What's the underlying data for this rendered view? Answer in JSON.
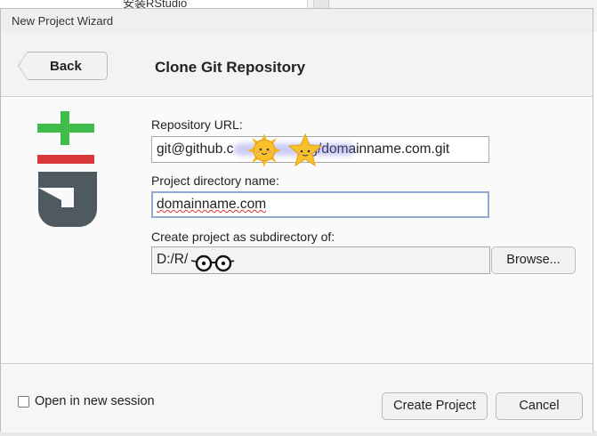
{
  "background": {
    "partial_text": "安装RStudio"
  },
  "dialog": {
    "title": "New Project Wizard",
    "back_label": "Back",
    "page_title": "Clone Git Repository"
  },
  "form": {
    "repo_url_label": "Repository URL:",
    "repo_url_prefix": "git@github.c",
    "repo_url_suffix": "g/domainname.com.git",
    "project_dir_label": "Project directory name:",
    "project_dir_value": "domainname.com",
    "subdir_label": "Create project as subdirectory of:",
    "subdir_value": "D:/R/​",
    "browse_label": "Browse..."
  },
  "footer": {
    "open_new_session_label": "Open in new session",
    "open_new_session_checked": false,
    "create_label": "Create Project",
    "cancel_label": "Cancel"
  },
  "colors": {
    "git_green": "#3fbc4a",
    "git_red": "#d9373a",
    "git_gray": "#4e5a60",
    "focus_border": "#8fa9d3"
  },
  "icons": {
    "logo": "git-logo",
    "sticker_1": "sun-sticker",
    "sticker_2": "star-sticker",
    "sticker_3": "glasses-sticker"
  }
}
